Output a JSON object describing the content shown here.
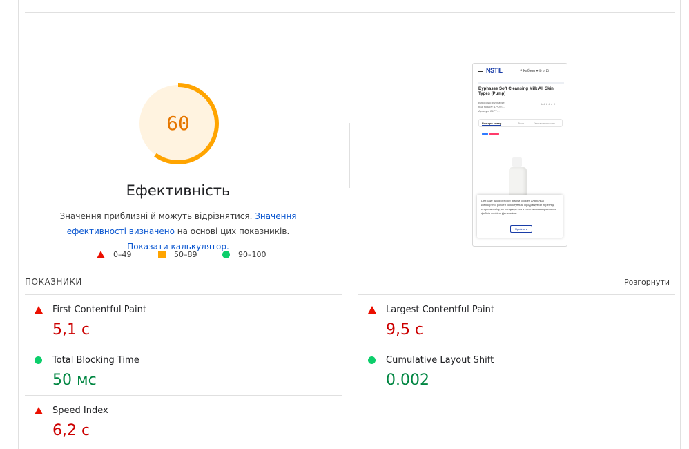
{
  "score": {
    "value": 60,
    "fraction": 0.6,
    "title": "Ефективність",
    "color": "#ffa400",
    "bg_color": "#fff3e0"
  },
  "description": {
    "text1": "Значення приблизні й можуть відрізнятися.",
    "link1": "Значення ефективності визначено",
    "text2": "на основі цих показників.",
    "link2": "Показати калькулятор."
  },
  "legend": [
    {
      "shape": "triangle",
      "range": "0–49",
      "color": "#eb0f00"
    },
    {
      "shape": "square",
      "range": "50–89",
      "color": "#ffa400"
    },
    {
      "shape": "circle",
      "range": "90–100",
      "color": "#0cce6b"
    }
  ],
  "screenshot": {
    "logo": "NSTIL",
    "header_icons": "⚲ Кабінет ▾   ✆  ⌕  ⊡",
    "product_title": "Byphasse Soft Cleansing Milk All Skin Types (Pump)",
    "meta": "Виробник: Byphasse\nКод товару: 1PO(I)…\nАртикул: 24PT…",
    "stars": "★★★★★ 0",
    "tabs": [
      "Все про товар",
      "Фото",
      "Характеристики"
    ],
    "cookie_text": "Цей сайт використовує файли cookies для більш комфортної роботи користувача. Продовжуючи перегляд сторінок сайту, ви погоджуєтеся з політикою використання файлів cookies. Детальніше",
    "cookie_button": "Прийняти"
  },
  "metrics": {
    "section_label": "ПОКАЗНИКИ",
    "expand_label": "Розгорнути",
    "items": [
      {
        "name": "First Contentful Paint",
        "value": "5,1 с",
        "status": "bad"
      },
      {
        "name": "Largest Contentful Paint",
        "value": "9,5 с",
        "status": "bad"
      },
      {
        "name": "Total Blocking Time",
        "value": "50 мс",
        "status": "good"
      },
      {
        "name": "Cumulative Layout Shift",
        "value": "0.002",
        "status": "good"
      },
      {
        "name": "Speed Index",
        "value": "6,2 с",
        "status": "bad"
      }
    ]
  }
}
